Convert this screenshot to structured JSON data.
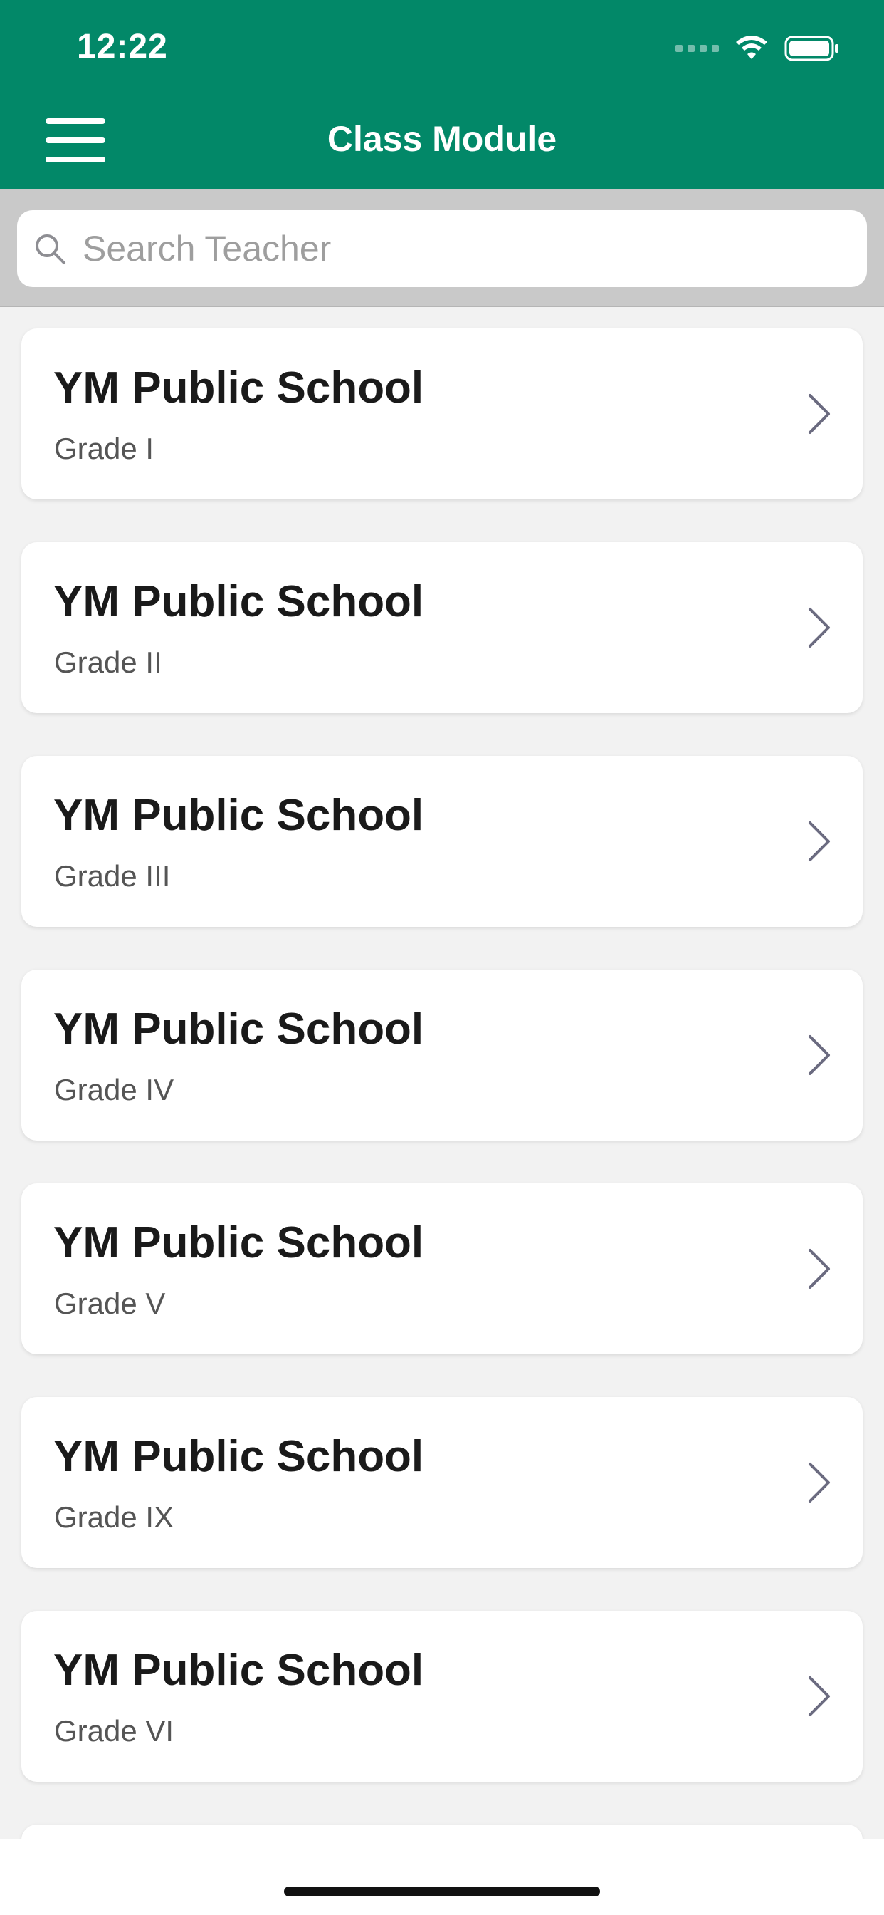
{
  "status_bar": {
    "time": "12:22"
  },
  "nav": {
    "title": "Class Module",
    "menu_icon": "hamburger-menu-icon"
  },
  "search": {
    "placeholder": "Search Teacher",
    "value": ""
  },
  "classes": [
    {
      "school": "YM Public School",
      "grade": "Grade I"
    },
    {
      "school": "YM Public School",
      "grade": "Grade II"
    },
    {
      "school": "YM Public School",
      "grade": "Grade III"
    },
    {
      "school": "YM Public School",
      "grade": "Grade IV"
    },
    {
      "school": "YM Public School",
      "grade": "Grade V"
    },
    {
      "school": "YM Public School",
      "grade": "Grade IX"
    },
    {
      "school": "YM Public School",
      "grade": "Grade VI"
    }
  ],
  "colors": {
    "header": "#028868",
    "background": "#f2f2f2",
    "search_area": "#c9c9c9",
    "card": "#ffffff",
    "chevron": "#6b6b80"
  }
}
